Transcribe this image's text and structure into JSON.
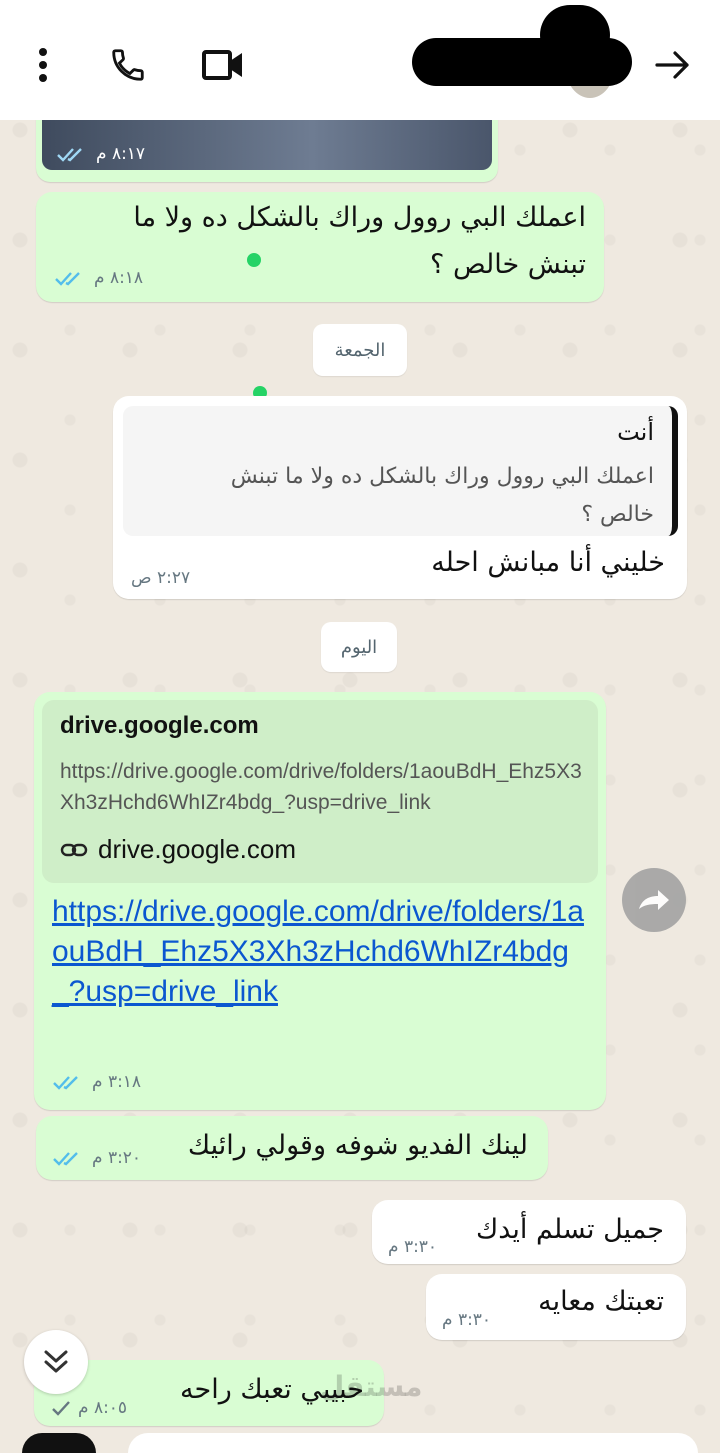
{
  "header": {
    "menu_icon": "more-vert-icon",
    "call_icon": "phone-icon",
    "video_icon": "video-camera-icon",
    "back_icon": "arrow-forward-icon"
  },
  "messages": {
    "m1": {
      "time": "٨:١٧ م"
    },
    "m2": {
      "text": "اعملك البي روول وراك بالشكل ده ولا ما تبنش خالص ؟",
      "time": "٨:١٨ م"
    },
    "date1": "الجمعة",
    "m3": {
      "quote_author": "أنت",
      "quote_text": "اعملك البي روول وراك بالشكل ده ولا ما تبنش خالص ؟",
      "text": "خليني أنا مبانش احله",
      "time": "٢:٢٧ ص"
    },
    "date2": "اليوم",
    "m4": {
      "preview_title": "drive.google.com",
      "preview_desc": "https://drive.google.com/drive/folders/1aouBdH_Ehz5X3Xh3zHchd6WhIZr4bdg_?usp=drive_link",
      "preview_domain": "drive.google.com",
      "link": "https://drive.google.com/drive/folders/1aouBdH_Ehz5X3Xh3zHchd6WhIZr4bdg_?usp=drive_link",
      "time": "٣:١٨ م"
    },
    "m5": {
      "text": "لينك الفديو شوفه وقولي رائيك",
      "time": "٣:٢٠ م"
    },
    "m6": {
      "text": "جميل تسلم أيدك",
      "time": "٣:٣٠ م"
    },
    "m7": {
      "text": "تعبتك معايه",
      "time": "٣:٣٠ م"
    },
    "m8": {
      "text": "حبيبي تعبك راحه",
      "time": "٨:٠٥ م"
    }
  },
  "watermark": "مستقل",
  "colors": {
    "outgoing": "#d9fdd3",
    "incoming": "#ffffff",
    "read_ticks": "#53bdeb",
    "link": "#0b57d0"
  }
}
